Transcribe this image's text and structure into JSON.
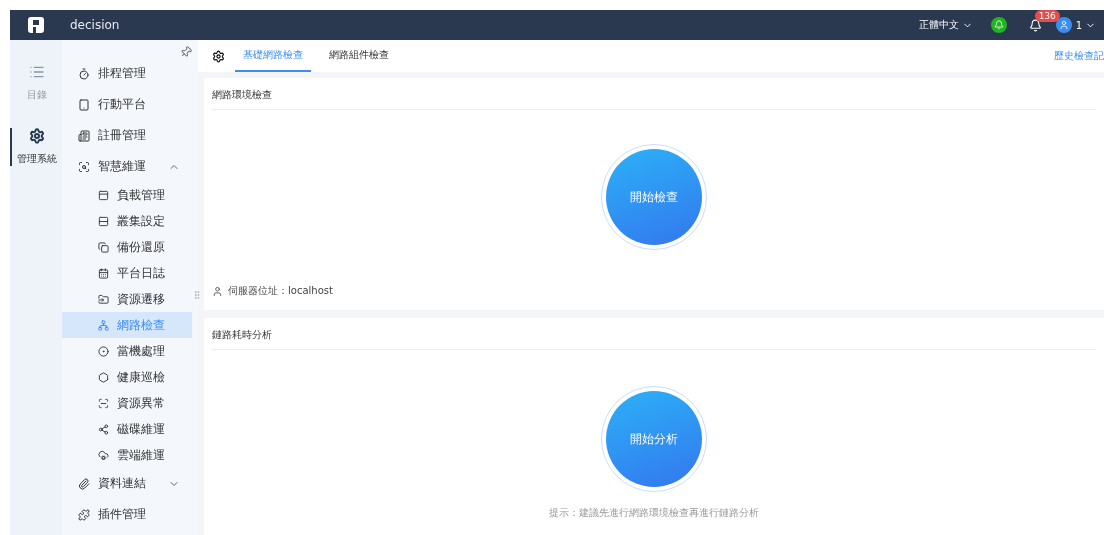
{
  "header": {
    "app_name": "decision",
    "language": "正體中文",
    "notification_count": "136",
    "user": "1"
  },
  "rail": [
    {
      "label": "目錄",
      "selected": false
    },
    {
      "label": "管理系統",
      "selected": true
    }
  ],
  "menu": [
    {
      "label": "排程管理",
      "selected": false
    },
    {
      "label": "行動平台",
      "selected": false
    },
    {
      "label": "註冊管理",
      "selected": false
    },
    {
      "label": "智慧維運",
      "selected": false,
      "expanded": true,
      "children": [
        {
          "label": "負載管理",
          "selected": false
        },
        {
          "label": "叢集設定",
          "selected": false
        },
        {
          "label": "備份還原",
          "selected": false
        },
        {
          "label": "平台日誌",
          "selected": false
        },
        {
          "label": "資源遷移",
          "selected": false
        },
        {
          "label": "網路檢查",
          "selected": true
        },
        {
          "label": "當機處理",
          "selected": false
        },
        {
          "label": "健康巡檢",
          "selected": false
        },
        {
          "label": "資源異常",
          "selected": false
        },
        {
          "label": "磁碟維運",
          "selected": false
        },
        {
          "label": "雲端維運",
          "selected": false
        }
      ]
    },
    {
      "label": "資料連結",
      "selected": false,
      "expanded": false
    },
    {
      "label": "插件管理",
      "selected": false
    }
  ],
  "tabs": [
    {
      "label": "基礎網路檢查",
      "selected": true
    },
    {
      "label": "網路組件檢查",
      "selected": false
    }
  ],
  "history_link": "歷史檢查記",
  "panels": [
    {
      "title": "網路環境檢查",
      "button": "開始檢查",
      "server_label": "伺服器位址：localhost"
    },
    {
      "title": "鏈路耗時分析",
      "button": "開始分析",
      "hint": "提示：建議先進行網路環境檢查再進行鏈路分析"
    }
  ]
}
